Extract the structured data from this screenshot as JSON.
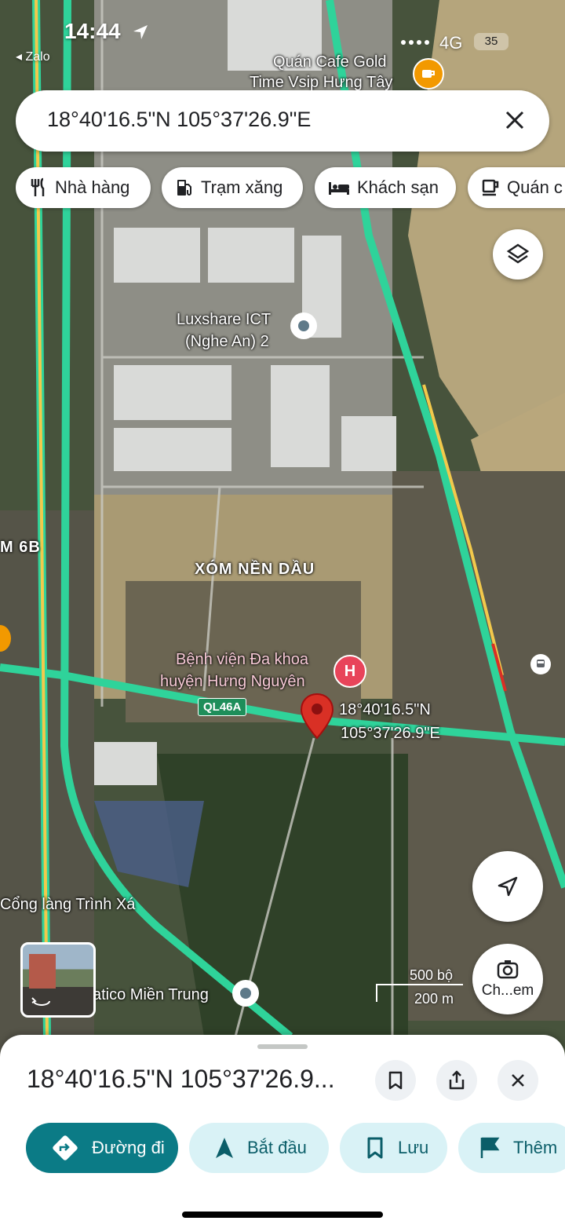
{
  "status_bar": {
    "time": "14:44",
    "back_app": "◂ Zalo",
    "network": "4G",
    "battery": "35"
  },
  "search": {
    "query": "18°40'16.5\"N 105°37'26.9\"E"
  },
  "chips": [
    {
      "label": "Nhà hàng",
      "icon": "restaurant-icon"
    },
    {
      "label": "Trạm xăng",
      "icon": "gas-station-icon"
    },
    {
      "label": "Khách sạn",
      "icon": "hotel-icon"
    },
    {
      "label": "Quán c",
      "icon": "cafe-icon"
    }
  ],
  "map_labels": {
    "cafe_line1": "Quán Cafe Gold",
    "cafe_line2": "Time Vsip Hưng Tây",
    "luxshare_line1": "Luxshare ICT",
    "luxshare_line2": "(Nghe An) 2",
    "xom_nen_dau": "XÓM NỀN DẦU",
    "road_6b": "M 6B",
    "hospital_line1": "Bệnh viện Đa khoa",
    "hospital_line2": "huyện Hưng Nguyên",
    "road_ql46a": "QL46A",
    "pin_lat": "18°40'16.5\"N",
    "pin_lng": "105°37'26.9\"E",
    "cong_lang": "Cổng làng Trình Xá",
    "atico": "atico Miền Trung"
  },
  "scale": {
    "imperial": "500 bộ",
    "metric": "200 m"
  },
  "camera_button": {
    "label": "Ch...em"
  },
  "sheet": {
    "title": "18°40'16.5\"N 105°37'26.9..."
  },
  "actions": [
    {
      "label": "Đường đi",
      "icon": "directions-icon"
    },
    {
      "label": "Bắt đầu",
      "icon": "navigation-arrow-icon"
    },
    {
      "label": "Lưu",
      "icon": "bookmark-icon"
    },
    {
      "label": "Thêm",
      "icon": "flag-icon"
    }
  ],
  "colors": {
    "road_green": "#2fd39a",
    "primary": "#0b7b86",
    "secondary_bg": "#d9f2f6",
    "pin_red": "#d93025"
  }
}
